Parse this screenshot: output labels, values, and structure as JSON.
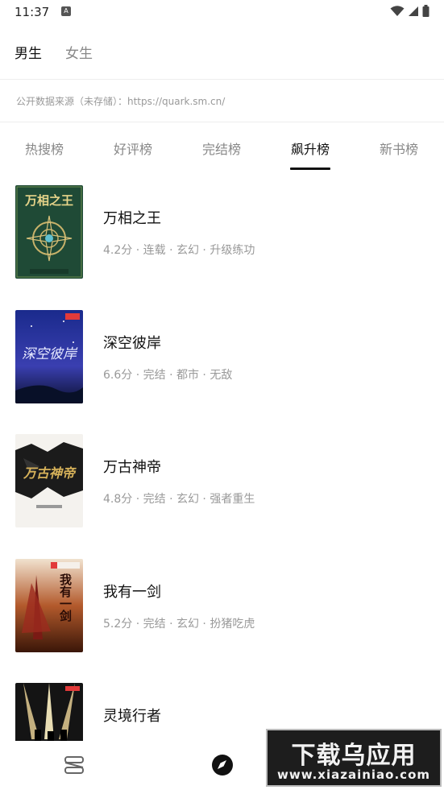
{
  "status_bar": {
    "time": "11:37",
    "app_icon_letter": "A"
  },
  "gender_tabs": [
    {
      "label": "男生",
      "active": true
    },
    {
      "label": "女生",
      "active": false
    }
  ],
  "source_text": "公开数据来源（未存储）：https://quark.sm.cn/",
  "rank_tabs": [
    {
      "label": "热搜榜",
      "active": false
    },
    {
      "label": "好评榜",
      "active": false
    },
    {
      "label": "完结榜",
      "active": false
    },
    {
      "label": "飙升榜",
      "active": true
    },
    {
      "label": "新书榜",
      "active": false
    }
  ],
  "books": [
    {
      "title": "万相之王",
      "meta": "4.2分 · 连载 · 玄幻 · 升级练功",
      "cover_text": "万相之王"
    },
    {
      "title": "深空彼岸",
      "meta": "6.6分 · 完结 · 都市 · 无敌",
      "cover_text": "深空彼岸"
    },
    {
      "title": "万古神帝",
      "meta": "4.8分 · 完结 · 玄幻 · 强者重生",
      "cover_text": "万古神帝"
    },
    {
      "title": "我有一剑",
      "meta": "5.2分 · 完结 · 玄幻 · 扮猪吃虎",
      "cover_text": "我有一剑"
    },
    {
      "title": "灵境行者",
      "meta": "",
      "cover_text": ""
    }
  ],
  "bottom_nav": [
    {
      "icon": "bookshelf-icon"
    },
    {
      "icon": "compass-icon"
    }
  ],
  "watermark": {
    "top": "下载乌应用",
    "bottom": "www.xiazainiao.com"
  },
  "colors": {
    "active_text": "#111111",
    "inactive_text": "#888888",
    "meta_text": "#999999"
  }
}
